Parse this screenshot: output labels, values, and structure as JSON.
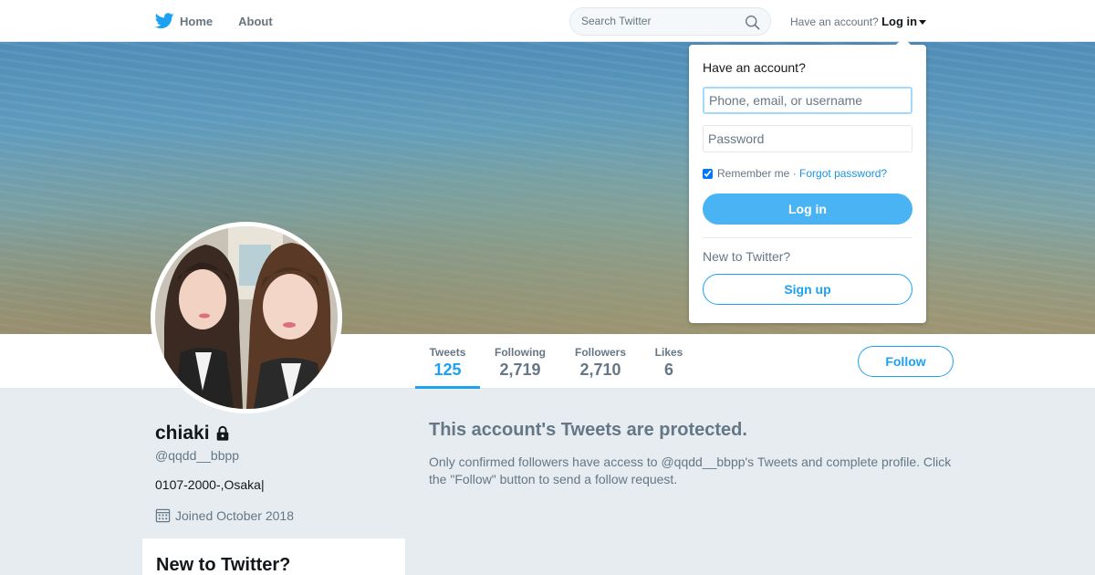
{
  "nav": {
    "home_label": "Home",
    "about_label": "About",
    "search_placeholder": "Search Twitter",
    "have_account_text": "Have an account?",
    "login_label": "Log in"
  },
  "profile": {
    "name": "chiaki",
    "handle": "@qqdd__bbpp",
    "bio": "0107-2000-,Osaka|",
    "joined": "Joined October 2018",
    "stats": [
      {
        "label": "Tweets",
        "value": "125"
      },
      {
        "label": "Following",
        "value": "2,719"
      },
      {
        "label": "Followers",
        "value": "2,710"
      },
      {
        "label": "Likes",
        "value": "6"
      }
    ],
    "follow_label": "Follow"
  },
  "protected": {
    "title": "This account's Tweets are protected.",
    "message": "Only confirmed followers have access to @qqdd__bbpp's Tweets and complete profile. Click the \"Follow\" button to send a follow request."
  },
  "sidebar": {
    "new_title": "New to Twitter?"
  },
  "login_dropdown": {
    "title": "Have an account?",
    "username_placeholder": "Phone, email, or username",
    "password_placeholder": "Password",
    "remember_label": "Remember me",
    "separator": "·",
    "forgot_label": "Forgot password?",
    "login_button": "Log in",
    "new_text": "New to Twitter?",
    "signup_button": "Sign up"
  },
  "colors": {
    "brand": "#1da1f2",
    "login_button": "#4ab3f4",
    "background": "#e6ecf0"
  }
}
